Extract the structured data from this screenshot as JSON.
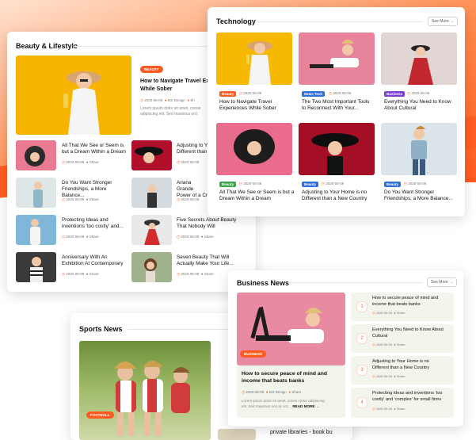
{
  "colors": {
    "accent": "#ff5a1f",
    "beauty": "#ff5a1f",
    "newstech": "#2f6fdb",
    "business": "#7b3fd1",
    "green": "#3aa74a"
  },
  "beauty_lifestyle": {
    "title": "Beauty & Lifestyle",
    "featured": {
      "badge": "BEAUTY",
      "headline": "How to Navigate Travel Ex... While Sober",
      "headline_l1": "How to Navigate Travel Ex",
      "headline_l2": "While Sober",
      "date": "2020-06-09",
      "author": "MS Design",
      "extra": "Sh",
      "excerpt": "Lorem ipsum dolor sit amet, conse adipiscing elit. Sed maximus orci"
    },
    "items": [
      {
        "l1": "All That We See or Seem is",
        "l2": "but a Dream Within a Dream",
        "date": "2020-06-09",
        "share": "Share"
      },
      {
        "l1": "Adjusting to Y",
        "l2": "Different than",
        "date": "2020-06-09",
        "share": "Share"
      },
      {
        "l1": "Do You Want Stronger",
        "l2": "Friendships, a More Balance...",
        "date": "2020-06-09",
        "share": "Share"
      },
      {
        "l1": "Ariana Grande",
        "l2": "Power of a Cr",
        "date": "2020-06-09",
        "share": "Share"
      },
      {
        "l1": "Protecting Ideas and",
        "l2": "inventions 'too costly' and...",
        "date": "2020-06-09",
        "share": "Share"
      },
      {
        "l1": "Five Secrets About Beauty",
        "l2": "That Nobody Will",
        "date": "2020-06-09",
        "share": "Share"
      },
      {
        "l1": "Anniversary With An",
        "l2": "Exhibition At Contemporary",
        "date": "2020-06-09",
        "share": "Share"
      },
      {
        "l1": "Seven Beauty That Will",
        "l2": "Actually Make Your Life...",
        "date": "2020-06-09",
        "share": "Share"
      }
    ]
  },
  "technology": {
    "title": "Technology",
    "see_more": "See More",
    "items": [
      {
        "badge": "Beauty",
        "date": "2020-06-09",
        "l1": "How to Navigate Travel",
        "l2": "Experiences While Sober"
      },
      {
        "badge": "News Tech",
        "date": "2020-06-09",
        "l1": "The Two Most Important Tools",
        "l2": "to Reconnect With Your..."
      },
      {
        "badge": "Business",
        "date": "2020-06-09",
        "l1": "Everything You Need to Know",
        "l2": "About Cultural"
      },
      {
        "badge": "Beauty",
        "date": "2020-06-09",
        "l1": "All That We See or Seem is but a",
        "l2": "Dream Within a Dream"
      },
      {
        "badge": "Beauty",
        "date": "2020-06-09",
        "l1": "Adjusting to Your Home is no",
        "l2": "Different than a New Country"
      },
      {
        "badge": "Beauty",
        "date": "2020-06-09",
        "l1": "Do You Want Stronger",
        "l2": "Friendships, a More Balance..."
      }
    ]
  },
  "business_news": {
    "title": "Business News",
    "see_more": "See More",
    "featured": {
      "badge": "BUSINESS",
      "l1": "How to secure peace of mind and",
      "l2": "income that beats banks",
      "date": "2020-06-09",
      "author": "MS Design",
      "share": "Share",
      "excerpt_l1": "Lorem ipsum dolor sit amet, conse ctetur adipiscing",
      "excerpt_l2": "elit. Sed maximus orci ac scc...",
      "read_more": "READ MORE"
    },
    "items": [
      {
        "num": "1",
        "l1": "How to secure peace of mind and",
        "l2": "income that beats banks",
        "date": "2020-06-09",
        "share": "Share"
      },
      {
        "num": "2",
        "l1": "Everything You Need to Know About",
        "l2": "Cultural",
        "date": "2020-06-09",
        "share": "Share"
      },
      {
        "num": "3",
        "l1": "Adjusting to Your Home is no",
        "l2": "Different than a New Country",
        "date": "2020-06-09",
        "share": "Share"
      },
      {
        "num": "4",
        "l1": "Protecting Ideas and inventions 'too",
        "l2": "costly' and 'complex' for small firms",
        "date": "2020-06-09",
        "share": "Share"
      }
    ]
  },
  "sports_news": {
    "title": "Sports News",
    "badge": "FOOTBALL",
    "side_text": "private libraries - book bu"
  }
}
